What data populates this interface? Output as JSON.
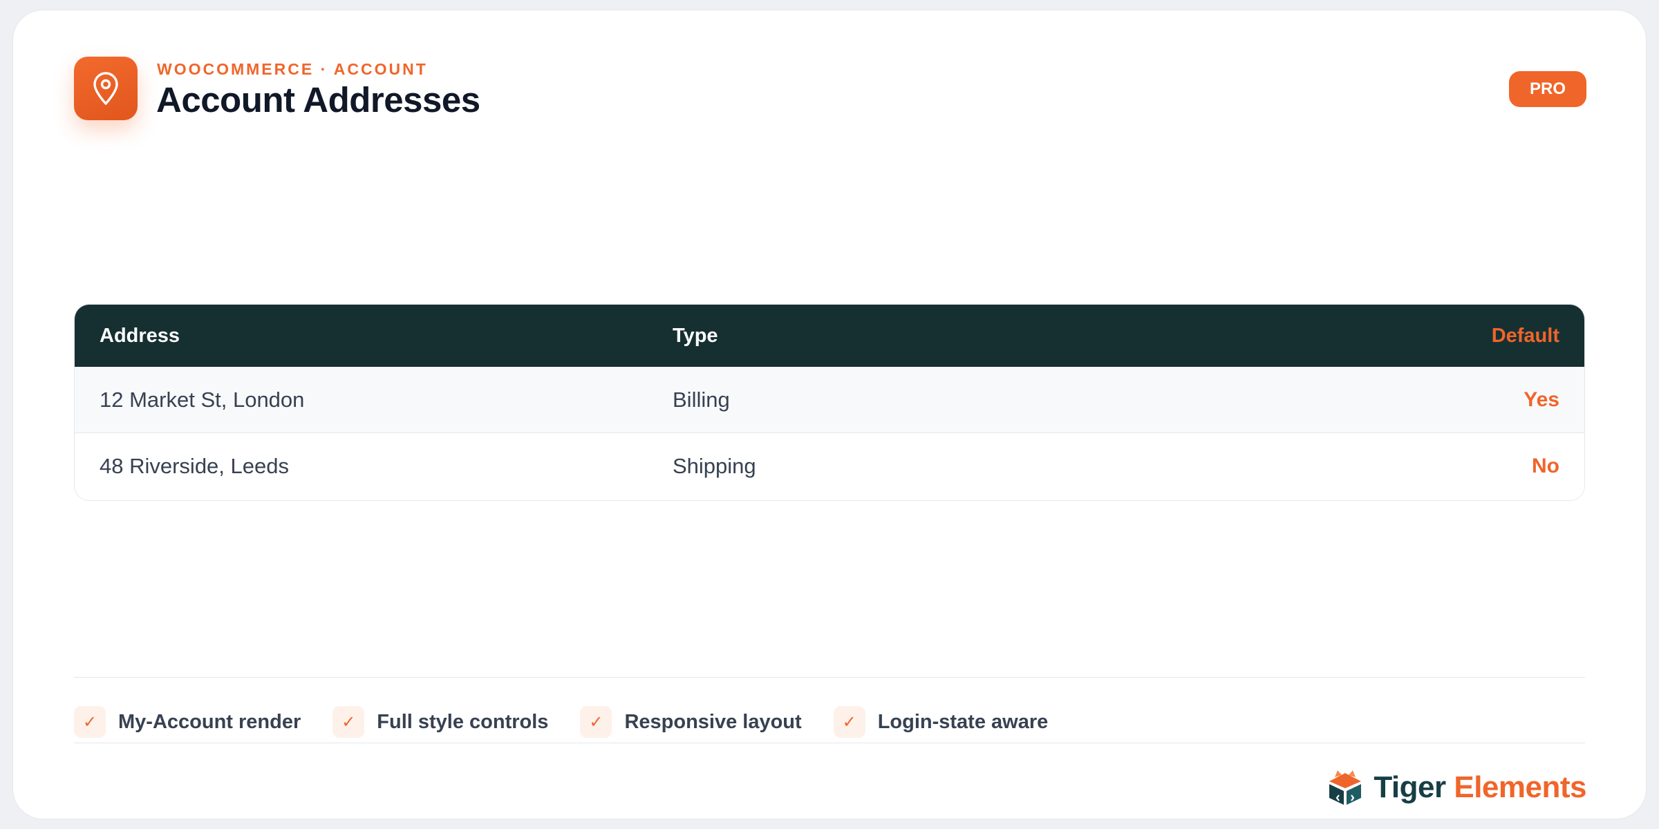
{
  "header": {
    "eyebrow": "WOOCOMMERCE · ACCOUNT",
    "title": "Account Addresses",
    "badge": "PRO",
    "icon": "location-pin-icon"
  },
  "table": {
    "columns": [
      "Address",
      "Type",
      "Default"
    ],
    "rows": [
      {
        "address": "12 Market St, London",
        "type": "Billing",
        "default": "Yes"
      },
      {
        "address": "48 Riverside, Leeds",
        "type": "Shipping",
        "default": "No"
      }
    ]
  },
  "features": [
    {
      "check": "✓",
      "label": "My-Account render"
    },
    {
      "check": "✓",
      "label": "Full style controls"
    },
    {
      "check": "✓",
      "label": "Responsive layout"
    },
    {
      "check": "✓",
      "label": "Login-state aware"
    }
  ],
  "brand": {
    "name_part1": "Tiger",
    "name_part2": "Elements",
    "icon": "tiger-elements-logo-icon"
  },
  "colors": {
    "accent": "#f0652a",
    "table_header": "#163032",
    "brand_dark": "#163f45"
  }
}
